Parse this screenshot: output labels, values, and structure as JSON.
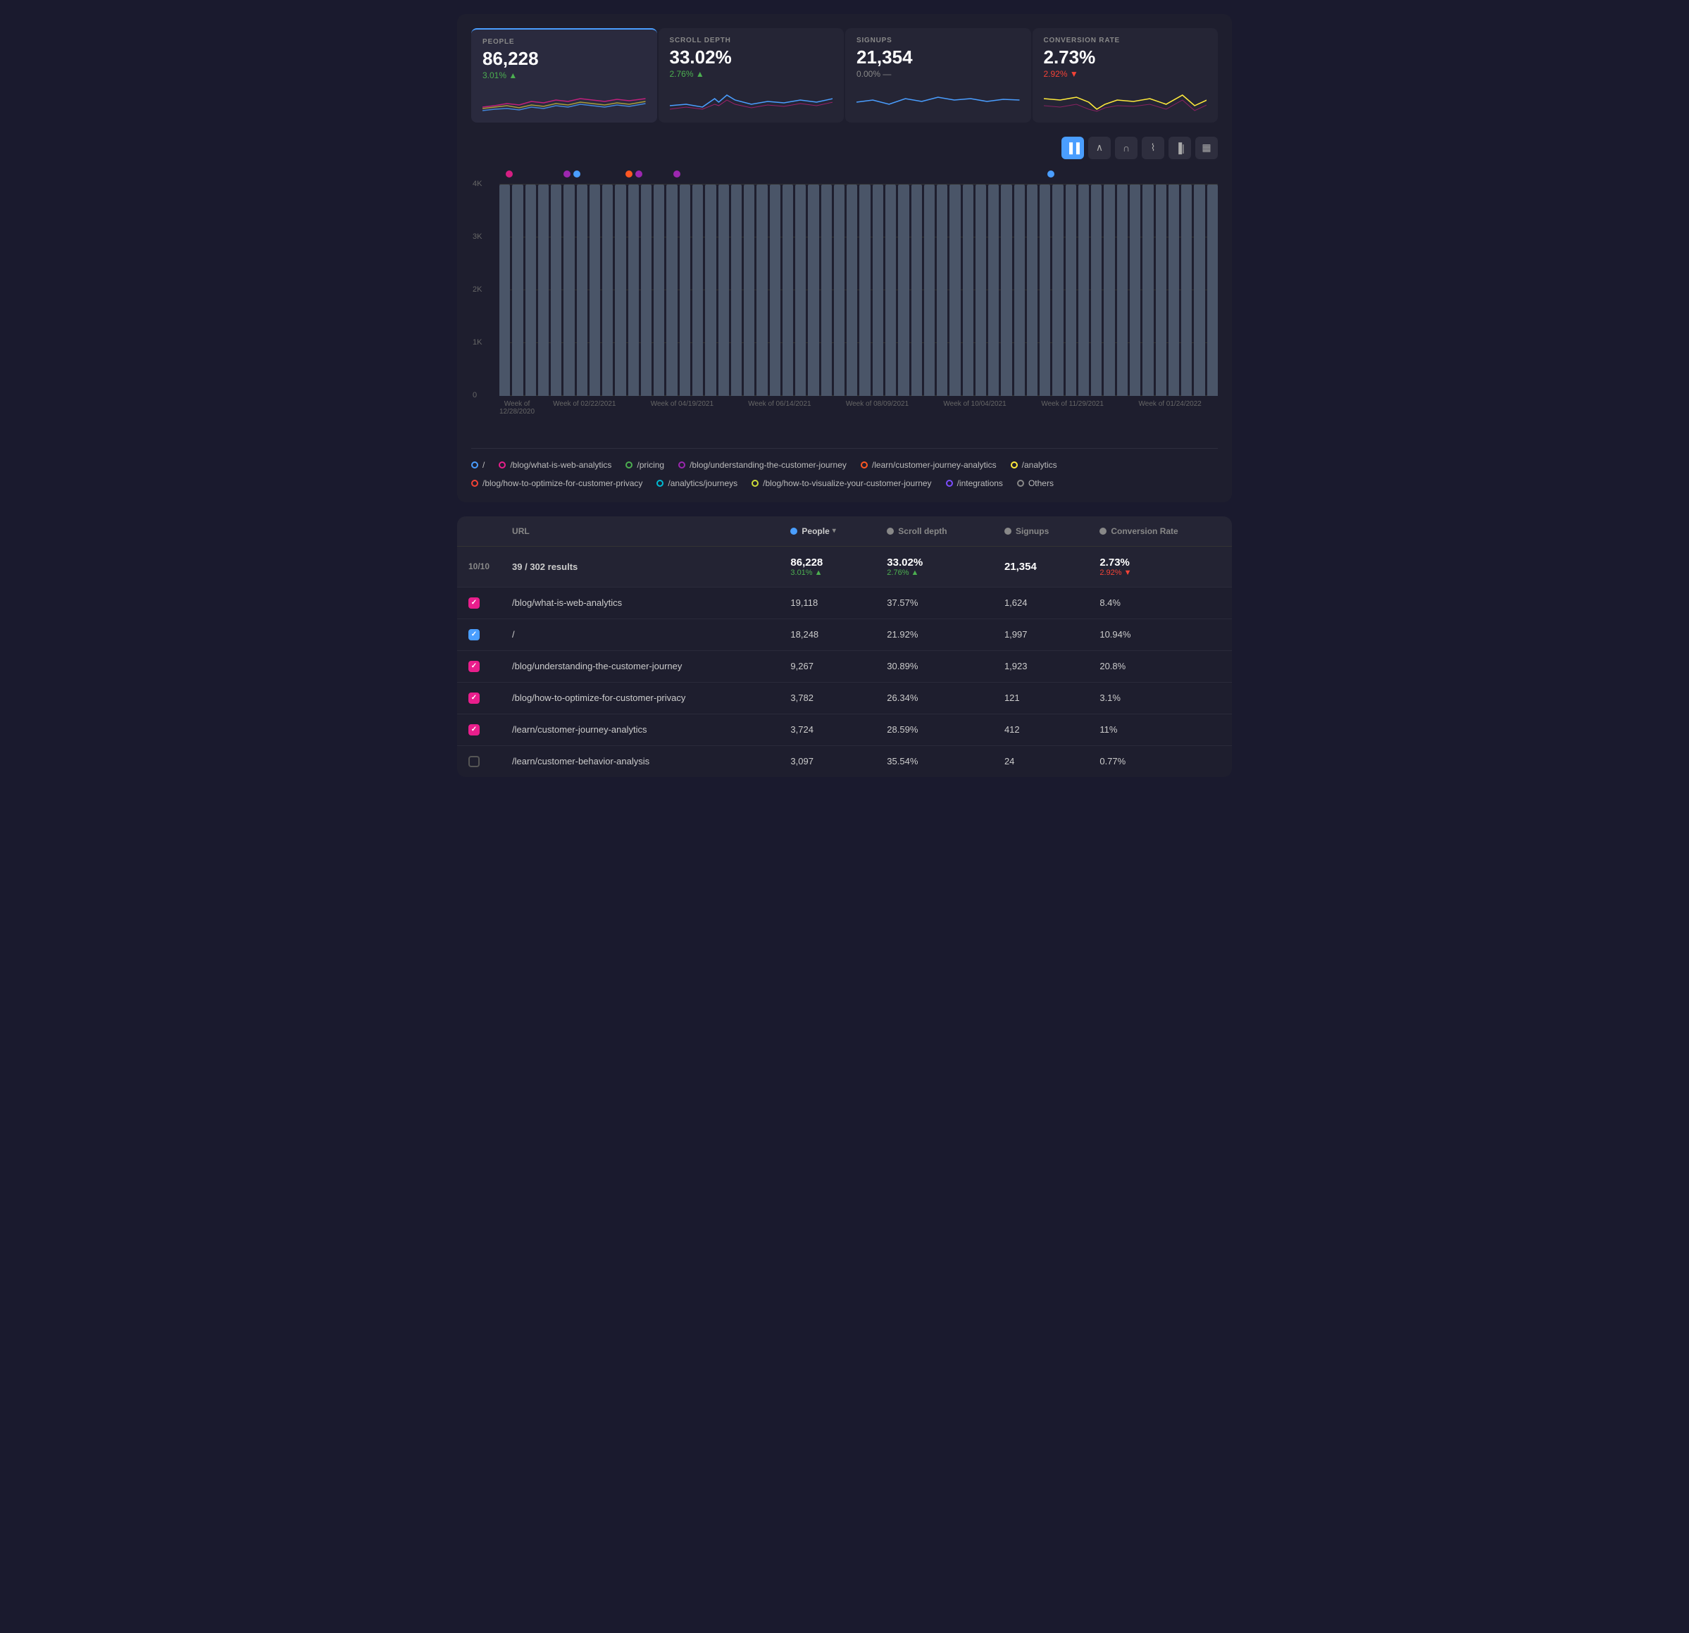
{
  "metrics": [
    {
      "id": "people",
      "label": "PEOPLE",
      "value": "86,228",
      "change": "3.01%",
      "change_dir": "up",
      "active": true
    },
    {
      "id": "scroll_depth",
      "label": "SCROLL DEPTH",
      "value": "33.02%",
      "change": "2.76%",
      "change_dir": "up",
      "active": false
    },
    {
      "id": "signups",
      "label": "SIGNUPS",
      "value": "21,354",
      "change": "0.00%",
      "change_dir": "flat",
      "active": false
    },
    {
      "id": "conversion_rate",
      "label": "CONVERSION RATE",
      "value": "2.73%",
      "change": "2.92%",
      "change_dir": "down",
      "active": false
    }
  ],
  "toolbar_buttons": [
    {
      "id": "bar",
      "icon": "▐▐",
      "active": true
    },
    {
      "id": "trend_up",
      "icon": "∧",
      "active": false
    },
    {
      "id": "trend_down",
      "icon": "∩",
      "active": false
    },
    {
      "id": "area",
      "icon": "⌇",
      "active": false
    },
    {
      "id": "histogram",
      "icon": "▐|",
      "active": false
    },
    {
      "id": "calendar",
      "icon": "▦",
      "active": false
    }
  ],
  "chart": {
    "y_labels": [
      "4K",
      "3K",
      "2K",
      "1K",
      "0"
    ],
    "x_labels": [
      "Week of 12/28/2020",
      "Week of 02/22/2021",
      "Week of 04/19/2021",
      "Week of 06/14/2021",
      "Week of 08/09/2021",
      "Week of 10/04/2021",
      "Week of 11/29/2021",
      "Week of 01/24/2022"
    ]
  },
  "legend": [
    {
      "label": "/",
      "color": "#4a9eff",
      "border": "#4a9eff"
    },
    {
      "label": "/blog/what-is-web-analytics",
      "color": "#e91e8c",
      "border": "#e91e8c"
    },
    {
      "label": "/pricing",
      "color": "#4caf50",
      "border": "#4caf50"
    },
    {
      "label": "/blog/understanding-the-customer-journey",
      "color": "#9c27b0",
      "border": "#9c27b0"
    },
    {
      "label": "/learn/customer-journey-analytics",
      "color": "#ff5722",
      "border": "#ff5722"
    },
    {
      "label": "/analytics",
      "color": "#ffeb3b",
      "border": "#ffeb3b"
    },
    {
      "label": "/blog/how-to-optimize-for-customer-privacy",
      "color": "#f44336",
      "border": "#f44336"
    },
    {
      "label": "/analytics/journeys",
      "color": "#00bcd4",
      "border": "#00bcd4"
    },
    {
      "label": "/blog/how-to-visualize-your-customer-journey",
      "color": "#cddc39",
      "border": "#cddc39"
    },
    {
      "label": "/integrations",
      "color": "#7c4dff",
      "border": "#7c4dff"
    },
    {
      "label": "Others",
      "color": "#888",
      "border": "#888"
    }
  ],
  "table": {
    "headers": {
      "url": "URL",
      "people": "People",
      "scroll_depth": "Scroll depth",
      "signups": "Signups",
      "conversion_rate": "Conversion Rate"
    },
    "page_count": "10/10",
    "result_count": "39 / 302 results",
    "totals": {
      "people": "86,228",
      "people_change": "3.01%",
      "people_dir": "up",
      "scroll": "33.02%",
      "scroll_change": "2.76%",
      "scroll_dir": "up",
      "signups": "21,354",
      "conversion": "2.73%",
      "conversion_change": "2.92%",
      "conversion_dir": "down"
    },
    "rows": [
      {
        "checked": "pink",
        "url": "/blog/what-is-web-analytics",
        "people": "19,118",
        "scroll": "37.57%",
        "signups": "1,624",
        "conversion": "8.4%"
      },
      {
        "checked": "blue",
        "url": "/",
        "people": "18,248",
        "scroll": "21.92%",
        "signups": "1,997",
        "conversion": "10.94%"
      },
      {
        "checked": "pink",
        "url": "/blog/understanding-the-customer-journey",
        "people": "9,267",
        "scroll": "30.89%",
        "signups": "1,923",
        "conversion": "20.8%"
      },
      {
        "checked": "pink",
        "url": "/blog/how-to-optimize-for-customer-privacy",
        "people": "3,782",
        "scroll": "26.34%",
        "signups": "121",
        "conversion": "3.1%"
      },
      {
        "checked": "pink",
        "url": "/learn/customer-journey-analytics",
        "people": "3,724",
        "scroll": "28.59%",
        "signups": "412",
        "conversion": "11%"
      },
      {
        "checked": "unchecked",
        "url": "/learn/customer-behavior-analysis",
        "people": "3,097",
        "scroll": "35.54%",
        "signups": "24",
        "conversion": "0.77%"
      }
    ]
  }
}
